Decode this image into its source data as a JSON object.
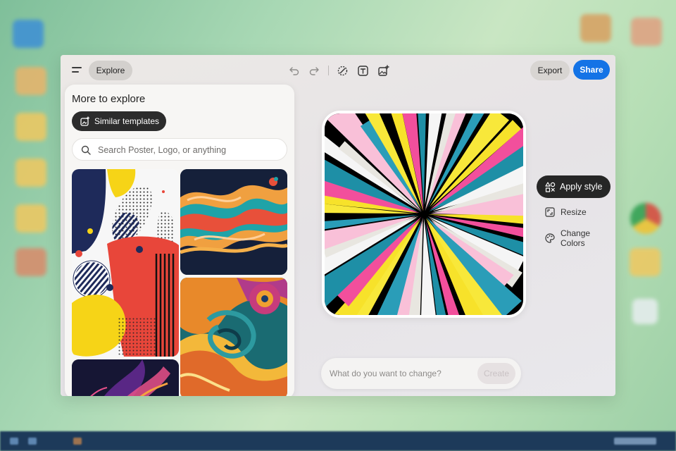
{
  "toolbar": {
    "explore_label": "Explore",
    "export_label": "Export",
    "share_label": "Share",
    "share_color": "#1473e6",
    "icons": [
      "undo-icon",
      "redo-icon",
      "remove-background-icon",
      "text-icon",
      "add-image-icon"
    ]
  },
  "panel": {
    "title": "More to explore",
    "similar_label": "Similar templates",
    "search_placeholder": "Search Poster, Logo, or anything"
  },
  "actions": {
    "apply_style": "Apply style",
    "resize": "Resize",
    "change_colors": "Change Colors"
  },
  "prompt": {
    "placeholder": "What do you want to change?",
    "create_label": "Create"
  }
}
